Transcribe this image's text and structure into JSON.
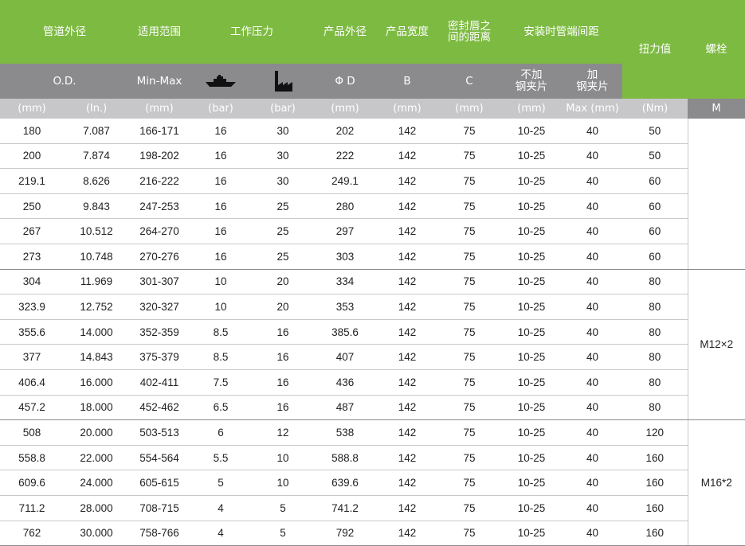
{
  "header": {
    "od": "管道外径",
    "range": "适用范围",
    "pressure": "工作压力",
    "product_od": "产品外径",
    "product_width": "产品宽度",
    "seal_gap_l1": "密封唇之",
    "seal_gap_l2": "间的距离",
    "install_gap": "安装时管端间距",
    "torque": "扭力值",
    "bolt": "螺栓"
  },
  "subheader": {
    "od": "O.D.",
    "minmax": "Min-Max",
    "ship_icon": "ship-icon",
    "factory_icon": "factory-icon",
    "phi_d": "Φ D",
    "b": "B",
    "c": "C",
    "no_clip_l1": "不加",
    "no_clip_l2": "钢夹片",
    "clip_l1": "加",
    "clip_l2": "钢夹片"
  },
  "units": [
    "(mm)",
    "(In.)",
    "(mm)",
    "(bar)",
    "(bar)",
    "(mm)",
    "(mm)",
    "(mm)",
    "(mm)",
    "Max (mm)",
    "(Nm)",
    "M"
  ],
  "rows": [
    [
      "180",
      "7.087",
      "166-171",
      "16",
      "30",
      "202",
      "142",
      "75",
      "10-25",
      "40",
      "50"
    ],
    [
      "200",
      "7.874",
      "198-202",
      "16",
      "30",
      "222",
      "142",
      "75",
      "10-25",
      "40",
      "50"
    ],
    [
      "219.1",
      "8.626",
      "216-222",
      "16",
      "30",
      "249.1",
      "142",
      "75",
      "10-25",
      "40",
      "60"
    ],
    [
      "250",
      "9.843",
      "247-253",
      "16",
      "25",
      "280",
      "142",
      "75",
      "10-25",
      "40",
      "60"
    ],
    [
      "267",
      "10.512",
      "264-270",
      "16",
      "25",
      "297",
      "142",
      "75",
      "10-25",
      "40",
      "60"
    ],
    [
      "273",
      "10.748",
      "270-276",
      "16",
      "25",
      "303",
      "142",
      "75",
      "10-25",
      "40",
      "60"
    ],
    [
      "304",
      "11.969",
      "301-307",
      "10",
      "20",
      "334",
      "142",
      "75",
      "10-25",
      "40",
      "80"
    ],
    [
      "323.9",
      "12.752",
      "320-327",
      "10",
      "20",
      "353",
      "142",
      "75",
      "10-25",
      "40",
      "80"
    ],
    [
      "355.6",
      "14.000",
      "352-359",
      "8.5",
      "16",
      "385.6",
      "142",
      "75",
      "10-25",
      "40",
      "80"
    ],
    [
      "377",
      "14.843",
      "375-379",
      "8.5",
      "16",
      "407",
      "142",
      "75",
      "10-25",
      "40",
      "80"
    ],
    [
      "406.4",
      "16.000",
      "402-411",
      "7.5",
      "16",
      "436",
      "142",
      "75",
      "10-25",
      "40",
      "80"
    ],
    [
      "457.2",
      "18.000",
      "452-462",
      "6.5",
      "16",
      "487",
      "142",
      "75",
      "10-25",
      "40",
      "80"
    ],
    [
      "508",
      "20.000",
      "503-513",
      "6",
      "12",
      "538",
      "142",
      "75",
      "10-25",
      "40",
      "120"
    ],
    [
      "558.8",
      "22.000",
      "554-564",
      "5.5",
      "10",
      "588.8",
      "142",
      "75",
      "10-25",
      "40",
      "160"
    ],
    [
      "609.6",
      "24.000",
      "605-615",
      "5",
      "10",
      "639.6",
      "142",
      "75",
      "10-25",
      "40",
      "160"
    ],
    [
      "711.2",
      "28.000",
      "708-715",
      "4",
      "5",
      "741.2",
      "142",
      "75",
      "10-25",
      "40",
      "160"
    ],
    [
      "762",
      "30.000",
      "758-766",
      "4",
      "5",
      "792",
      "142",
      "75",
      "10-25",
      "40",
      "160"
    ]
  ],
  "bolts": [
    {
      "label": "",
      "rows": 6
    },
    {
      "label": "M12×2",
      "rows": 6
    },
    {
      "label": "M16*2",
      "rows": 5
    }
  ],
  "colors": {
    "header_green": "#7dba42",
    "subheader_gray": "#8b8b8d",
    "unit_row_gray": "#c7c7c9"
  }
}
